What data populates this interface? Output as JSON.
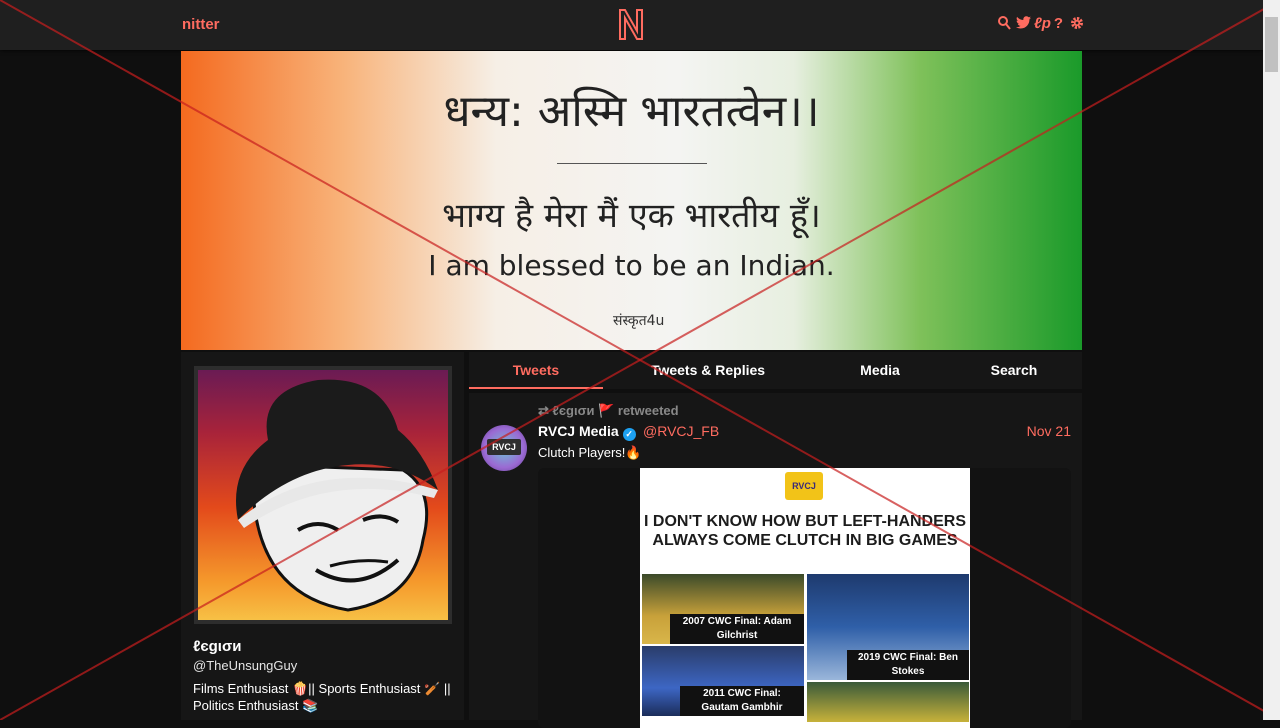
{
  "nav": {
    "brand": "nitter",
    "logo_letter": "N",
    "icons": [
      "search-icon",
      "twitter-bird-icon",
      "rss-icon",
      "help-icon",
      "settings-gear-icon"
    ],
    "icon_glyphs": [
      "⌕",
      "✦",
      "ℓ",
      "?",
      "⚙"
    ]
  },
  "banner": {
    "line1": "धन्य: अस्मि भारतत्वेन।।",
    "line2": "भाग्य है मेरा मैं एक भारतीय हूँ।",
    "line3": "I am blessed to be an Indian.",
    "signature": "संस्कृत4u"
  },
  "profile": {
    "fullname": "ℓєgισи",
    "username": "@TheUnsungGuy",
    "bio": "Films Enthusiast 🍿|| Sports Enthusiast 🏏 || Politics Enthusiast 📚"
  },
  "tabs": [
    "Tweets",
    "Tweets & Replies",
    "Media",
    "Search"
  ],
  "tweet": {
    "retweet_text": "ℓєgισи 🚩  retweeted",
    "name": "RVCJ Media",
    "handle": "@RVCJ_FB",
    "date": "Nov 21",
    "text": "Clutch Players!🔥",
    "avatar_tag": "RVCJ",
    "media": {
      "logo": "RVCJ",
      "headline": "I DON'T KNOW HOW BUT LEFT-HANDERS ALWAYS COME CLUTCH IN BIG GAMES",
      "captions": [
        "2007 CWC Final: Adam Gilchrist",
        "2019 CWC Final: Ben Stokes",
        "2011 CWC Final: Gautam Gambhir"
      ]
    }
  }
}
